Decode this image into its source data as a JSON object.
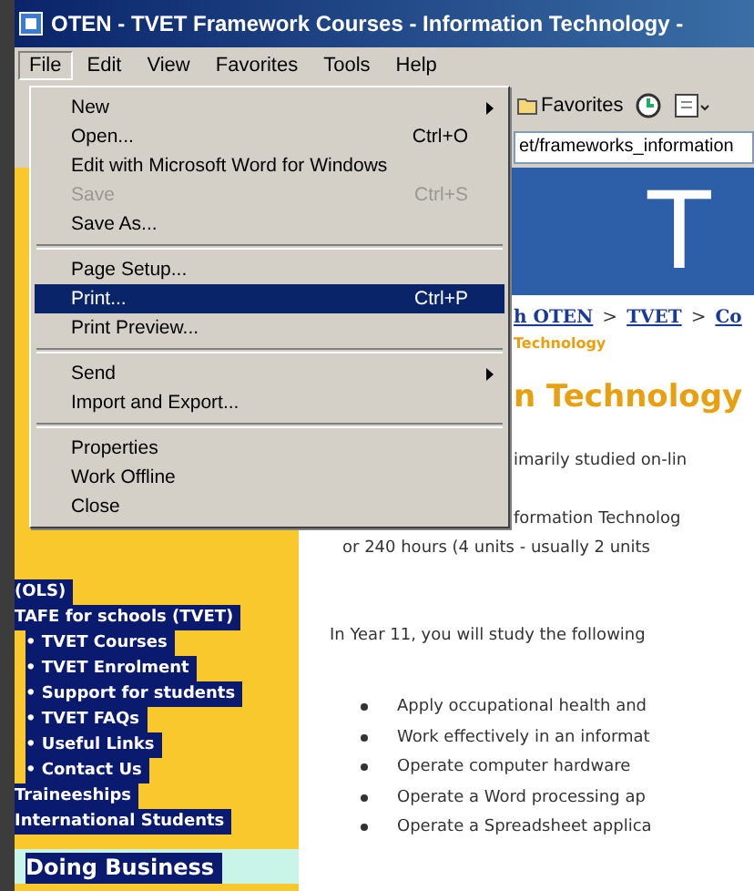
{
  "window": {
    "title": "OTEN - TVET Framework Courses - Information Technology -"
  },
  "menu_bar": [
    {
      "label": "File",
      "selected": true
    },
    {
      "label": "Edit",
      "selected": false
    },
    {
      "label": "View",
      "selected": false
    },
    {
      "label": "Favorites",
      "selected": false
    },
    {
      "label": "Tools",
      "selected": false
    },
    {
      "label": "Help",
      "selected": false
    }
  ],
  "file_menu": [
    {
      "kind": "item",
      "label": "New",
      "submenu": true,
      "disabled": false,
      "selected": false
    },
    {
      "kind": "item",
      "label": "Open...",
      "shortcut": "Ctrl+O",
      "submenu": false,
      "disabled": false,
      "selected": false
    },
    {
      "kind": "item",
      "label": "Edit with Microsoft Word for Windows",
      "submenu": false,
      "disabled": false,
      "selected": false
    },
    {
      "kind": "item",
      "label": "Save",
      "shortcut": "Ctrl+S",
      "submenu": false,
      "disabled": true,
      "selected": false
    },
    {
      "kind": "item",
      "label": "Save As...",
      "submenu": false,
      "disabled": false,
      "selected": false
    },
    {
      "kind": "separator"
    },
    {
      "kind": "item",
      "label": "Page Setup...",
      "submenu": false,
      "disabled": false,
      "selected": false
    },
    {
      "kind": "item",
      "label": "Print...",
      "shortcut": "Ctrl+P",
      "submenu": false,
      "disabled": false,
      "selected": true
    },
    {
      "kind": "item",
      "label": "Print Preview...",
      "submenu": false,
      "disabled": false,
      "selected": false
    },
    {
      "kind": "separator"
    },
    {
      "kind": "item",
      "label": "Send",
      "submenu": true,
      "disabled": false,
      "selected": false
    },
    {
      "kind": "item",
      "label": "Import and Export...",
      "submenu": false,
      "disabled": false,
      "selected": false
    },
    {
      "kind": "separator"
    },
    {
      "kind": "item",
      "label": "Properties",
      "submenu": false,
      "disabled": false,
      "selected": false
    },
    {
      "kind": "item",
      "label": "Work Offline",
      "submenu": false,
      "disabled": false,
      "selected": false
    },
    {
      "kind": "item",
      "label": "Close",
      "submenu": false,
      "disabled": false,
      "selected": false
    }
  ],
  "toolbar": {
    "favorites": "Favorites"
  },
  "address": {
    "value": "et/frameworks_information"
  },
  "banner": {
    "letter": "T"
  },
  "breadcrumb": [
    {
      "kind": "link",
      "text": "h OTEN"
    },
    {
      "kind": "separator",
      "text": ">"
    },
    {
      "kind": "link",
      "text": "TVET"
    },
    {
      "kind": "separator",
      "text": ">"
    },
    {
      "kind": "link",
      "text": "Co"
    }
  ],
  "subtitle": "Technology",
  "heading": "n Technology",
  "paragraphs": [
    {
      "kind": "cut",
      "text": "imarily studied on-lin"
    },
    {
      "kind": "cut",
      "text": "formation Technolog"
    },
    {
      "kind": "full",
      "text": "or 240 hours (4 units - usually 2 units"
    },
    {
      "kind": "full",
      "text": "In Year 11, you will study the following"
    }
  ],
  "units": [
    "Apply occupational health and",
    "Work effectively in an informat",
    "Operate computer hardware",
    "Operate a Word processing ap",
    "Operate a Spreadsheet applica"
  ],
  "sidebar": [
    {
      "kind": "section",
      "label": "(OLS)"
    },
    {
      "kind": "section",
      "label": "TAFE for schools (TVET)"
    },
    {
      "kind": "sub",
      "label": "• TVET Courses"
    },
    {
      "kind": "sub",
      "label": "• TVET Enrolment"
    },
    {
      "kind": "sub",
      "label": "• Support for students"
    },
    {
      "kind": "sub",
      "label": "• TVET FAQs"
    },
    {
      "kind": "sub",
      "label": "• Useful Links"
    },
    {
      "kind": "sub",
      "label": "• Contact Us"
    },
    {
      "kind": "section",
      "label": "Traineeships"
    },
    {
      "kind": "section",
      "label": "International Students"
    },
    {
      "kind": "major",
      "label": "Doing Business"
    }
  ]
}
